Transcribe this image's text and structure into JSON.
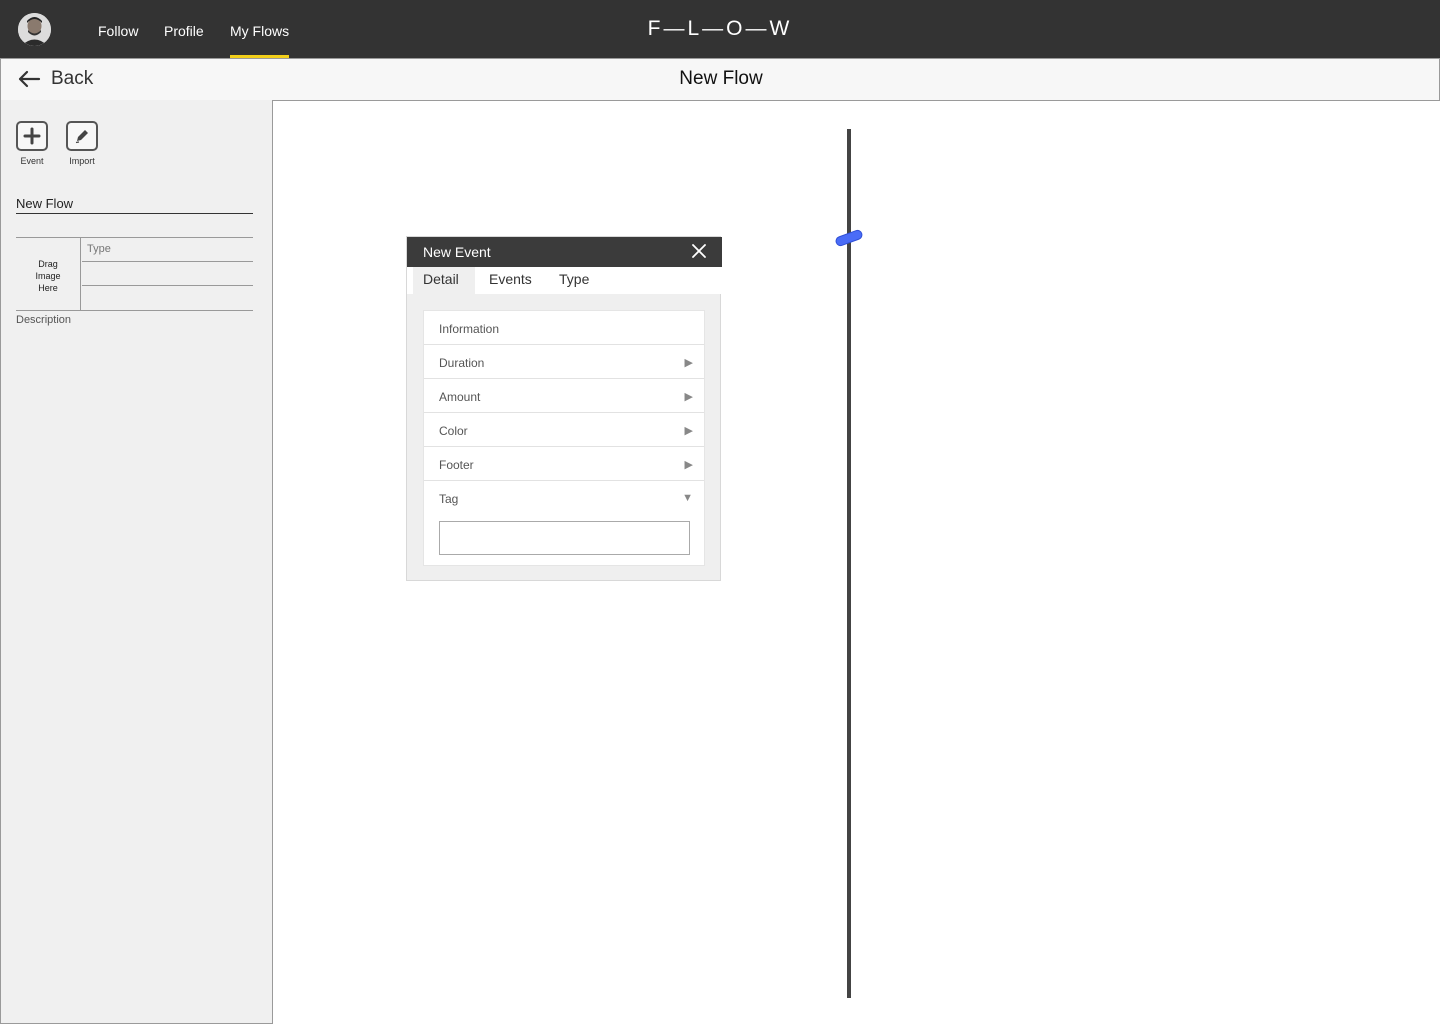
{
  "topbar": {
    "nav": [
      {
        "label": "Follow",
        "active": false
      },
      {
        "label": "Profile",
        "active": false
      },
      {
        "label": "My Flows",
        "active": true
      }
    ],
    "logo": "F—L—O—W",
    "accent_color": "#f2cf1a"
  },
  "subheader": {
    "back_label": "Back",
    "title": "New Flow"
  },
  "sidebar": {
    "tools": [
      {
        "label": "Event",
        "icon": "plus-square-icon"
      },
      {
        "label": "Import",
        "icon": "pencil-square-icon"
      }
    ],
    "flow_name": "New Flow",
    "drop_zone": "Drag Image Here",
    "type_label": "Type",
    "description_label": "Description"
  },
  "dialog": {
    "title": "New Event",
    "tabs": [
      {
        "label": "Detail",
        "active": true
      },
      {
        "label": "Events",
        "active": false
      },
      {
        "label": "Type",
        "active": false
      }
    ],
    "rows": [
      {
        "label": "Information",
        "arrow": ""
      },
      {
        "label": "Duration",
        "arrow": "▶"
      },
      {
        "label": "Amount",
        "arrow": "▶"
      },
      {
        "label": "Color",
        "arrow": "▶"
      },
      {
        "label": "Footer",
        "arrow": "▶"
      },
      {
        "label": "Tag",
        "arrow": "▼"
      }
    ],
    "tag_value": ""
  },
  "timeline": {
    "marker_color": "#4a6cf7"
  }
}
